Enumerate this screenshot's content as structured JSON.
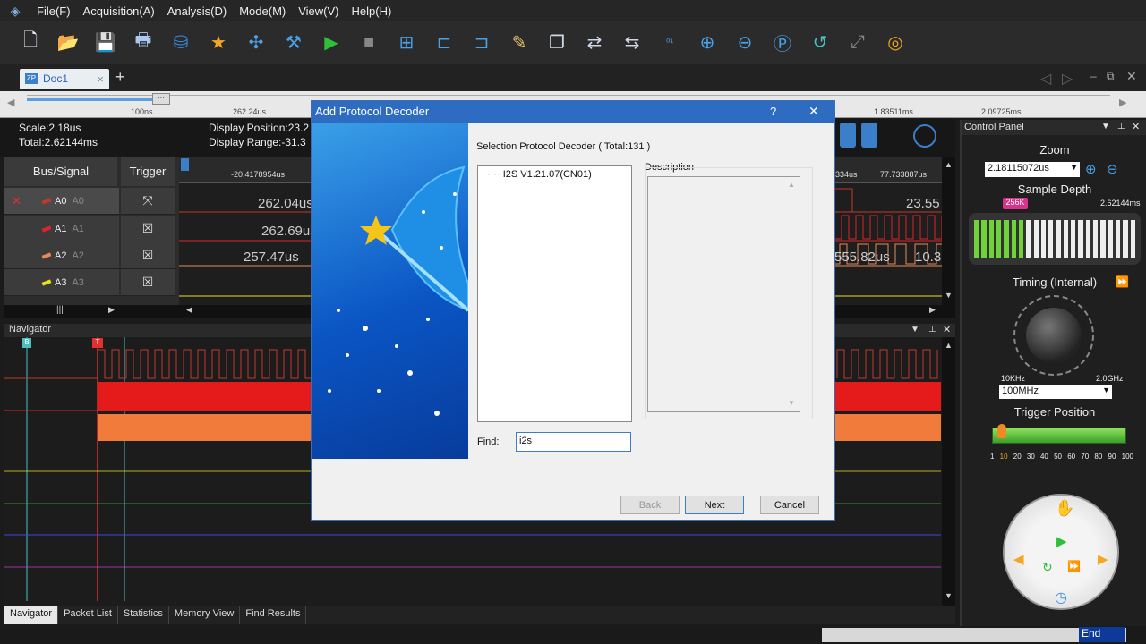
{
  "menu": [
    "File(F)",
    "Acquisition(A)",
    "Analysis(D)",
    "Mode(M)",
    "View(V)",
    "Help(H)"
  ],
  "doc_tab": {
    "label": "Doc1",
    "close": "×",
    "add": "+"
  },
  "overview": {
    "ticks": [
      "100ns",
      "262.24us",
      "1.83511ms",
      "2.09725ms"
    ],
    "thumb": "···"
  },
  "info": {
    "scale": "Scale:2.18us",
    "total": "Total:2.62144ms",
    "display_position": "Display Position:23.2",
    "display_range": "Display Range:-31.3"
  },
  "signal_panel": {
    "headers": {
      "bus_signal": "Bus/Signal",
      "trigger": "Trigger"
    },
    "rows": [
      {
        "name": "A0",
        "sub": "A0",
        "color": "#c0392b"
      },
      {
        "name": "A1",
        "sub": "A1",
        "color": "#d9262c"
      },
      {
        "name": "A2",
        "sub": "A2",
        "color": "#e58a5a"
      },
      {
        "name": "A3",
        "sub": "A3",
        "color": "#e6e01e"
      }
    ]
  },
  "wave": {
    "ruler": [
      "-20.4178954us",
      "334us",
      "77.733887us"
    ],
    "labels": [
      "262.04us",
      "262.69us",
      "257.47us",
      "23.55",
      "555.82us",
      "10.3"
    ]
  },
  "navigator": {
    "title": "Navigator",
    "markers": {
      "b": "B",
      "t": "T"
    }
  },
  "bottom_tabs": [
    "Navigator",
    "Packet List",
    "Statistics",
    "Memory View",
    "Find Results"
  ],
  "status": {
    "end": "End"
  },
  "control_panel": {
    "title": "Control Panel",
    "zoom_label": "Zoom",
    "zoom_value": "2.18115072us",
    "sample_depth_label": "Sample Depth",
    "sample_depth_badge": "256K",
    "sample_depth_value": "2.62144ms",
    "timing_label": "Timing (Internal)",
    "dial_min": "10KHz",
    "dial_max": "2.0GHz",
    "rate_value": "100MHz",
    "trigger_position_label": "Trigger Position",
    "trigger_scale": [
      "1",
      "10",
      "20",
      "30",
      "40",
      "50",
      "60",
      "70",
      "80",
      "90",
      "100"
    ],
    "accent": "#6fd23a"
  },
  "dialog": {
    "title": "Add Protocol Decoder",
    "help": "?",
    "close": "✕",
    "selection_label": "Selection Protocol Decoder ( Total:131 )",
    "tree_item": "I2S V1.21.07(CN01)",
    "description_label": "Description",
    "find_label": "Find:",
    "find_value": "i2s",
    "buttons": {
      "back": "Back",
      "next": "Next",
      "cancel": "Cancel"
    }
  }
}
